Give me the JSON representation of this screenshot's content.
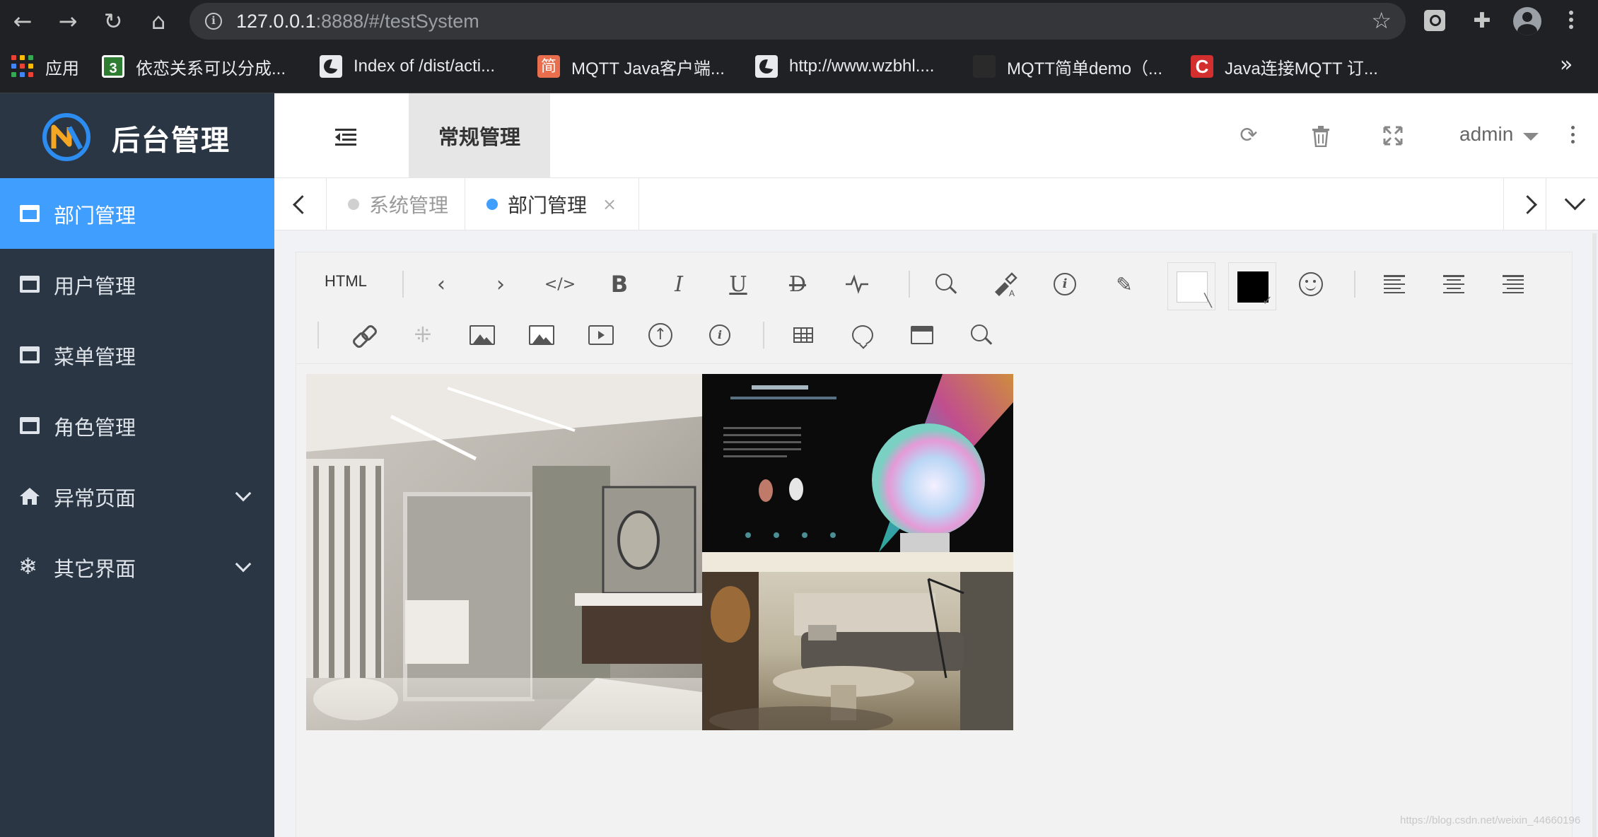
{
  "browser": {
    "url_host": "127.0.0.1",
    "url_rest": ":8888/#/testSystem",
    "bookmarks": [
      {
        "label": "应用",
        "icon": "apps-grid-icon"
      },
      {
        "label": "依恋关系可以分成...",
        "icon": "favicon-3-icon"
      },
      {
        "label": "Index of /dist/acti...",
        "icon": "globe-icon"
      },
      {
        "label": "MQTT Java客户端...",
        "icon": "jian-icon"
      },
      {
        "label": "http://www.wzbhl....",
        "icon": "globe-icon"
      },
      {
        "label": "MQTT简单demo（...",
        "icon": "dark-favicon-icon"
      },
      {
        "label": "Java连接MQTT 订...",
        "icon": "c-favicon-icon"
      }
    ],
    "more": "»"
  },
  "sidebar": {
    "logo_text": "后台管理",
    "items": [
      {
        "label": "部门管理",
        "active": true
      },
      {
        "label": "用户管理"
      },
      {
        "label": "菜单管理"
      },
      {
        "label": "角色管理"
      },
      {
        "label": "异常页面",
        "expandable": true
      },
      {
        "label": "其它界面",
        "expandable": true
      }
    ]
  },
  "header": {
    "top_nav": "常规管理",
    "user": "admin"
  },
  "tabs": [
    {
      "label": "系统管理",
      "active": false
    },
    {
      "label": "部门管理",
      "active": true,
      "close": "×"
    }
  ],
  "editor": {
    "html_label": "HTML"
  },
  "watermark": "https://blog.csdn.net/weixin_44660196",
  "colors": {
    "sidebar_bg": "#2b3644",
    "accent": "#409eff",
    "browser_bg": "#202124"
  }
}
